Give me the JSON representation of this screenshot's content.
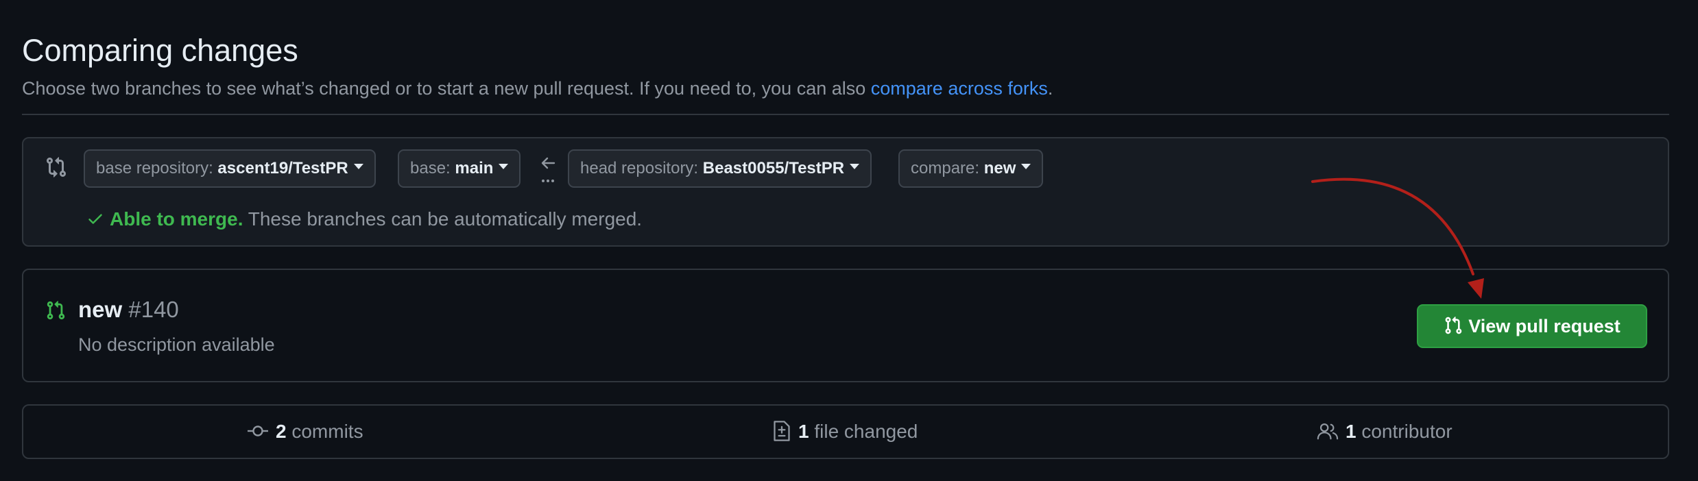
{
  "header": {
    "title": "Comparing changes",
    "subtitle": "Choose two branches to see what’s changed or to start a new pull request. If you need to, you can also ",
    "subtitle_link": "compare across forks",
    "subtitle_end": "."
  },
  "compare": {
    "base_repo_label": "base repository: ",
    "base_repo_value": "ascent19/TestPR",
    "base_label": "base: ",
    "base_value": "main",
    "head_repo_label": "head repository: ",
    "head_repo_value": "Beast0055/TestPR",
    "compare_label": "compare: ",
    "compare_value": "new",
    "merge_ok": "Able to merge.",
    "merge_msg": " These branches can be automatically merged."
  },
  "pull_request": {
    "branch": "new",
    "number": "#140",
    "description": "No description available",
    "view_button": "View pull request"
  },
  "stats": {
    "commits_count": "2",
    "commits_label": " commits",
    "files_count": "1",
    "files_label": " file changed",
    "contributors_count": "1",
    "contributors_label": " contributor"
  },
  "colors": {
    "background": "#0d1117",
    "accent_link": "#4493f8",
    "success": "#3fb950",
    "button_green": "#238636",
    "annotation_arrow": "#b3201a"
  }
}
